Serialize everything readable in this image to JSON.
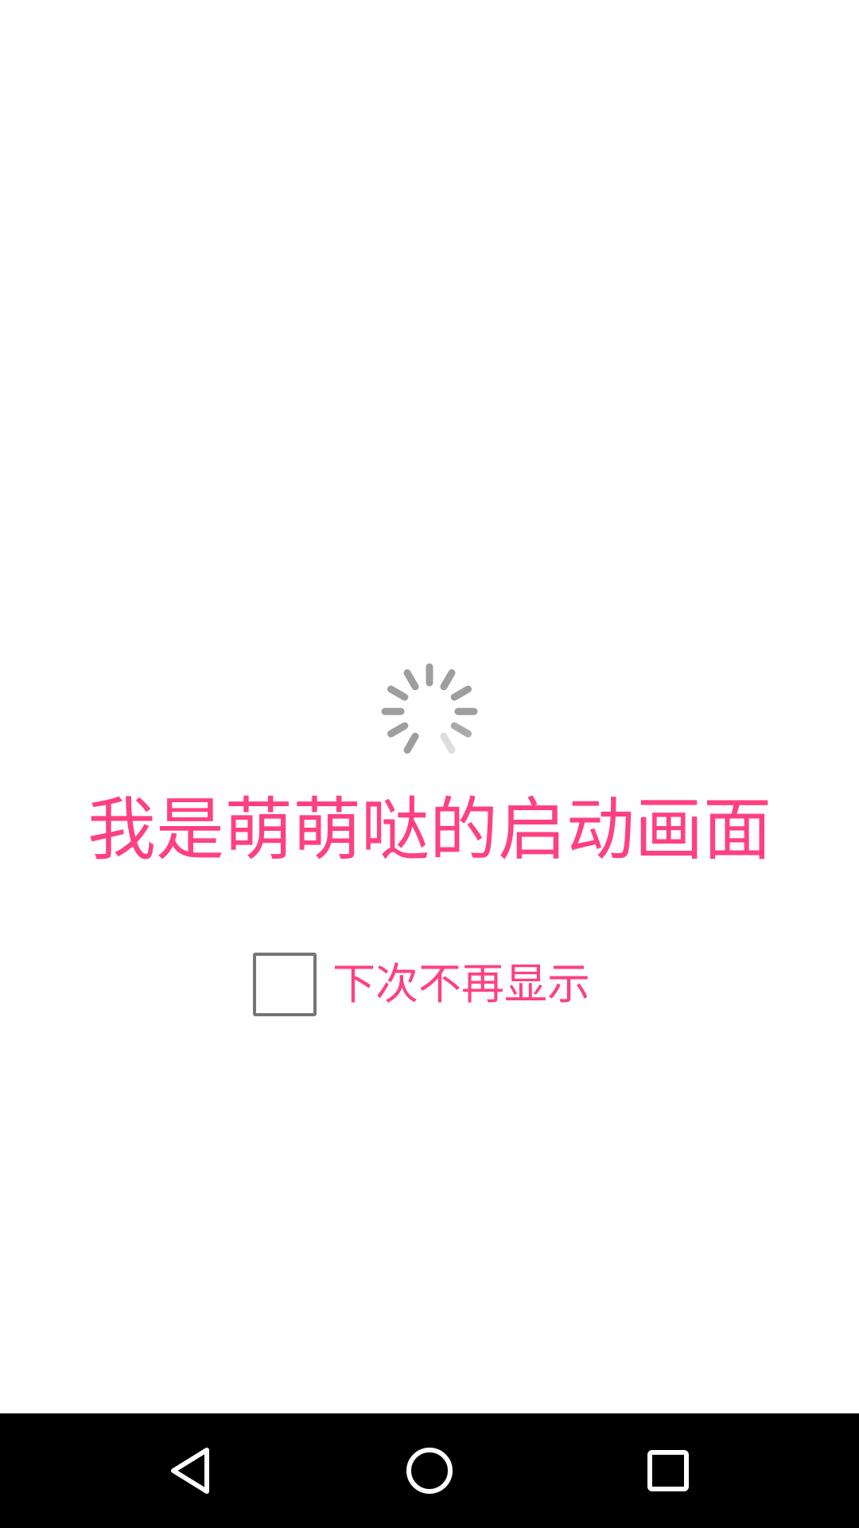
{
  "splash": {
    "title": "我是萌萌哒的启动画面",
    "dont_show_again_label": "下次不再显示",
    "dont_show_again_checked": false
  },
  "loading_indicator": {
    "icon": "loading-spinner-icon",
    "color": "#9E9E9E"
  },
  "colors": {
    "accent": "#FF4081",
    "background": "#FFFFFF",
    "navbar": "#000000"
  },
  "navigation_bar": {
    "back_icon": "back-triangle-icon",
    "home_icon": "home-circle-icon",
    "recents_icon": "recents-square-icon"
  }
}
